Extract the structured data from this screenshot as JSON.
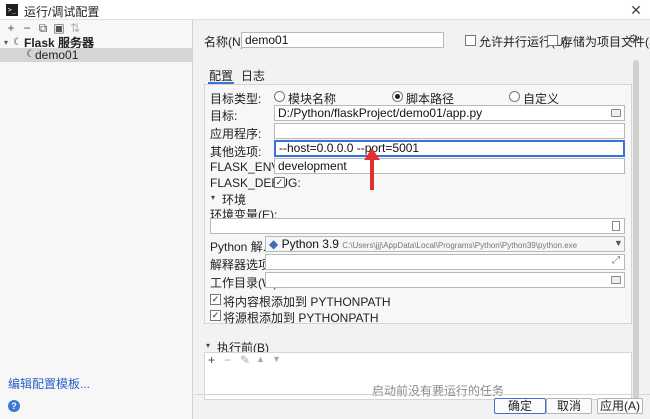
{
  "window": {
    "title": "运行/调试配置",
    "close_glyph": "✕",
    "app_icon_text": ">_"
  },
  "left_toolbar": {
    "add": "+",
    "remove": "−",
    "copy": "⧉",
    "folder": "▣",
    "sort": "⇅"
  },
  "tree": {
    "group_label": "Flask 服务器",
    "item_label": "demo01"
  },
  "edit_templates_link": "编辑配置模板...",
  "help_glyph": "?",
  "header": {
    "name_label": "名称(N):",
    "name_value": "demo01",
    "allow_parallel": "允许并行运行(U)",
    "store_as_file": "存储为项目文件(S)",
    "gear_glyph": "⚙"
  },
  "tabs": [
    {
      "label": "配置"
    },
    {
      "label": "日志"
    }
  ],
  "config": {
    "target_type_label": "目标类型:",
    "radio_module": "模块名称",
    "radio_script": "脚本路径",
    "radio_custom": "自定义",
    "target_label": "目标:",
    "target_value": "D:/Python/flaskProject/demo01/app.py",
    "app_label": "应用程序:",
    "app_value": "",
    "extra_label": "其他选项:",
    "extra_value": "--host=0.0.0.0 --port=5001",
    "env_label": "FLASK_ENV:",
    "env_value": "development",
    "debug_label": "FLASK_DEBUG:",
    "debug_checked": "✓",
    "env_section": "环境",
    "env_vars_label": "环境变量(E):",
    "env_vars_value": "",
    "interpreter_label": "Python 解...",
    "interpreter_name": "Python 3.9",
    "interpreter_path": "C:\\Users\\jjj\\AppData\\Local\\Programs\\Python\\Python39\\python.exe",
    "interp_options_label": "解释器选项:",
    "interp_options_value": "",
    "workdir_label": "工作目录(W):",
    "workdir_value": "",
    "add_content_roots": "将内容根添加到 PYTHONPATH",
    "add_source_roots": "将源根添加到 PYTHONPATH"
  },
  "before_launch": {
    "label": "执行前(B)",
    "empty_text": "启动前没有要运行的任务",
    "add": "+",
    "remove": "−",
    "edit": "✎",
    "up": "▲",
    "down": "▼"
  },
  "buttons": {
    "ok": "确定",
    "cancel": "取消",
    "apply": "应用(A)"
  },
  "colors": {
    "accent": "#3874d8",
    "arrow": "#e03030",
    "link": "#2a62c9"
  }
}
